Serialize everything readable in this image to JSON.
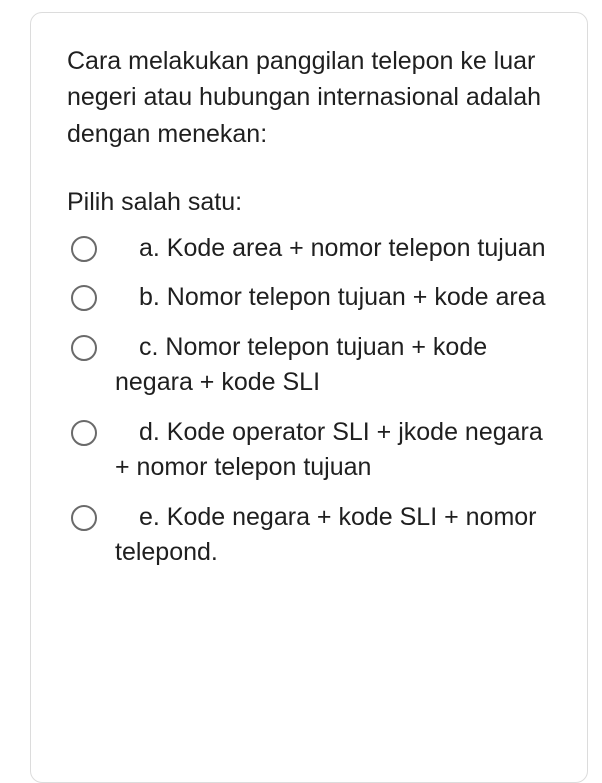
{
  "question": "Cara melakukan panggilan telepon ke luar negeri atau hubungan internasional adalah dengan menekan:",
  "instruction": "Pilih salah satu:",
  "options": [
    {
      "label": "a. Kode area + nomor telepon tujuan"
    },
    {
      "label": "b. Nomor telepon tujuan + kode area"
    },
    {
      "label": "c. Nomor telepon tujuan + kode negara + kode SLI"
    },
    {
      "label": "d. Kode operator SLI + jkode negara + nomor telepon tujuan"
    },
    {
      "label": "e. Kode negara + kode SLI + nomor telepond."
    }
  ]
}
